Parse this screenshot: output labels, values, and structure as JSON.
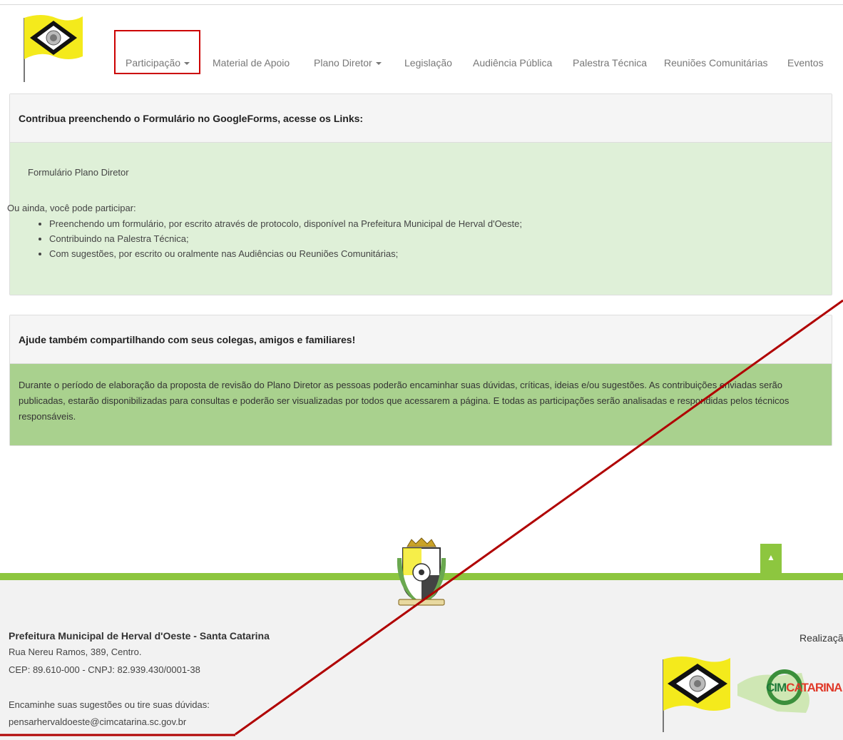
{
  "header": {
    "nav": [
      {
        "label": "Participação",
        "dropdown": true
      },
      {
        "label": "Material de Apoio",
        "dropdown": false
      },
      {
        "label": "Plano Diretor",
        "dropdown": true
      },
      {
        "label": "Legislação",
        "dropdown": false
      },
      {
        "label": "Audiência Pública",
        "dropdown": false
      },
      {
        "label": "Palestra Técnica",
        "dropdown": false
      },
      {
        "label": "Reuniões Comunitárias",
        "dropdown": false
      },
      {
        "label": "Eventos",
        "dropdown": false
      }
    ]
  },
  "panel1": {
    "heading": "Contribua preenchendo o Formulário no GoogleForms, acesse os Links:",
    "link": "Formulário Plano Diretor",
    "intro": "Ou ainda, você pode participar:",
    "items": [
      "Preenchendo um formulário, por escrito através de protocolo, disponível na Prefeitura Municipal de Herval d'Oeste;",
      "Contribuindo na Palestra Técnica;",
      "Com sugestões, por escrito ou oralmente nas Audiências ou Reuniões Comunitárias;"
    ]
  },
  "panel2": {
    "heading": "Ajude também compartilhando com seus colegas, amigos e familiares!",
    "body": "Durante o período de elaboração da proposta de revisão do Plano Diretor as pessoas poderão encaminhar suas dúvidas, críticas, ideias e/ou sugestões. As contribuições enviadas serão publicadas, estarão disponibilizadas para consultas e poderão ser visualizadas por todos que acessarem a página. E todas as participações serão analisadas e respondidas pelos técnicos responsáveis."
  },
  "footer": {
    "title": "Prefeitura Municipal de Herval d'Oeste - Santa Catarina",
    "address": "Rua Nereu Ramos, 389, Centro.",
    "cep": "CEP: 89.610-000 - CNPJ: 82.939.430/0001-38",
    "prompt": "Encaminhe suas sugestões ou tire suas dúvidas:",
    "email": "pensarhervaldoeste@cimcatarina.sc.gov.br",
    "realizacao": "Realização",
    "cim_logo": {
      "cim": "CIM",
      "catarina": "CATARINA"
    },
    "back_to_top_icon": "chevron-up-icon"
  },
  "colors": {
    "accent_green": "#8dc63f",
    "panel1_green": "#dff0d8",
    "panel2_green": "#a9d18e",
    "annotation_red": "#cc0000"
  }
}
